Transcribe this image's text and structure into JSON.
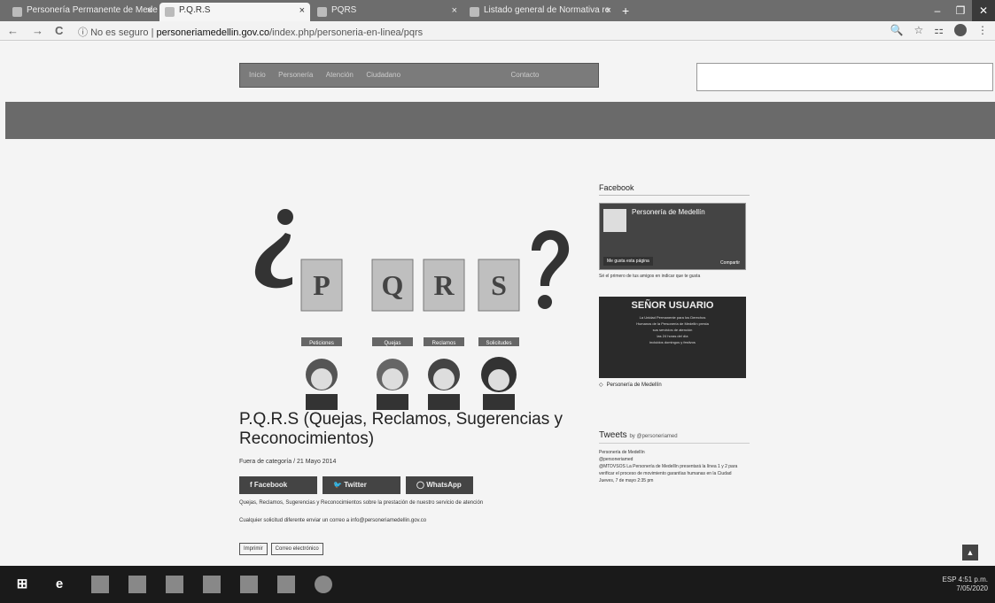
{
  "browser": {
    "tabs": [
      {
        "label": "Personería Permanente de Medellín",
        "active": false
      },
      {
        "label": "P.Q.R.S",
        "active": true
      },
      {
        "label": "PQRS",
        "active": false
      },
      {
        "label": "Listado general de Normativa re",
        "active": false
      }
    ],
    "new_tab": "+",
    "window_buttons": {
      "minimize": "–",
      "maximize": "❐",
      "close": "✕"
    },
    "nav": {
      "back": "←",
      "forward": "→",
      "reload": "C"
    },
    "security": "No es seguro",
    "url_domain": "personeriamedellin.gov.co",
    "url_path": "/index.php/personeria-en-linea/pqrs",
    "icons": {
      "zoom": "🔍",
      "star": "☆",
      "ext": "⚏"
    }
  },
  "site": {
    "nav_items": [
      "Inicio",
      "Personería",
      "Atención",
      "Ciudadano",
      "Contacto"
    ]
  },
  "article": {
    "title": "P.Q.R.S (Quejas, Reclamos, Sugerencias y Reconocimientos)",
    "meta": "Fuera de categoría  /  21 Mayo 2014",
    "share": {
      "facebook": "Facebook",
      "twitter": "Twitter",
      "whatsapp": "WhatsApp"
    },
    "body1": "Quejas, Reclamos, Sugerencias y Reconocimientos sobre la prestación de nuestro servicio de atención",
    "body2": "Cualquier solicitud diferente enviar un correo a info@personeriamedellin.gov.co",
    "tags": [
      "Imprimir",
      "Correo electrónico"
    ]
  },
  "hero": {
    "letters": [
      "P",
      "Q",
      "R",
      "S"
    ],
    "captions": [
      "Peticiones",
      "Quejas",
      "Reclamos",
      "Solicitudes"
    ]
  },
  "sidebar": {
    "facebook_title": "Facebook",
    "fb_page_name": "Personería de Medellín",
    "fb_likes": "Me gusta esta página",
    "fb_share": "Compartir",
    "fb_friends": "Sé el primero de tus amigos en indicar que te gusta",
    "notice_title": "SEÑOR USUARIO",
    "notice_lines": [
      "La Unidad Permanente para los Derechos",
      "Humanos de la Personería de Medellín presta",
      "sus servicios de atención",
      "las 24 horas del día",
      "incluidos domingos y festivos"
    ],
    "fb_footer": "Personería de Medellín",
    "tweets_title": "Tweets",
    "tweets_by": "by @personeriamed",
    "tweet_author": "Personería de Medellín",
    "tweet_handle": "@personeriamed",
    "tweet_text": "@MTDVSOS La Personería de Medellín presentará la línea 1 y 2 para verificar el proceso de movimiento garantías humanas en la Ciudad",
    "tweet_text2": "Jueves, 7 de mayo 2:35 pm"
  },
  "taskbar": {
    "start": "⊞",
    "ie": "e",
    "time": "4:51 p.m.",
    "date": "7/05/2020",
    "lang": "ESP"
  }
}
